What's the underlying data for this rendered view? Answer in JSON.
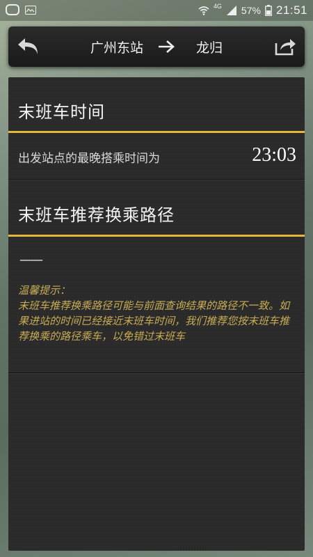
{
  "status_bar": {
    "network_label": "4G",
    "battery": "57%",
    "time": "21:51"
  },
  "header": {
    "from_station": "广州东站",
    "to_station": "龙归",
    "icons": [
      "back-arrow-icon",
      "right-arrow-icon",
      "share-icon"
    ]
  },
  "last_train": {
    "title": "末班车时间",
    "label": "出发站点的最晚搭乘时间为",
    "time": "23:03"
  },
  "route": {
    "title": "末班车推荐换乘路径",
    "value": "——"
  },
  "tip": {
    "heading": "温馨提示：",
    "body": "末班车推荐换乘路径可能与前面查询结果的路径不一致。如果进站的时间已经接近末班车时间，我们推荐您按末班车推荐换乘的路径乘车，以免错过末班车"
  },
  "colors": {
    "accent": "#e5b53c",
    "tip_text": "#c8ac55",
    "panel": "#2a2a2a"
  }
}
